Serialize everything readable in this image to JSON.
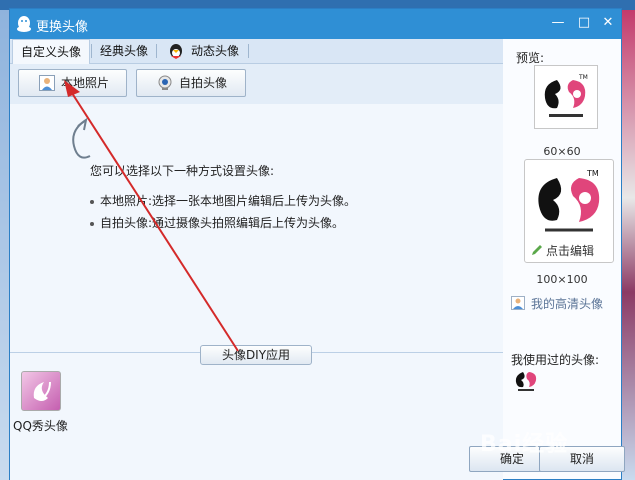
{
  "dialog": {
    "title": "更换头像",
    "controls": {
      "minimize": "—",
      "maximize": "□",
      "close": "✕"
    }
  },
  "tabs": [
    "自定义头像",
    "经典头像",
    "动态头像"
  ],
  "toolbar": {
    "local_photo": "本地照片",
    "selfie": "自拍头像"
  },
  "instructions": {
    "heading": "您可以选择以下一种方式设置头像:",
    "items": [
      "本地照片:选择一张本地图片编辑后上传为头像。",
      "自拍头像:通过摄像头拍照编辑后上传为头像。"
    ]
  },
  "diy_button": "头像DIY应用",
  "qq_show": {
    "label": "QQ秀头像"
  },
  "preview": {
    "label": "预览:",
    "small_size": "60×60",
    "large_size": "100×100",
    "edit_label": "点击编辑",
    "hd_link": "我的高清头像",
    "used_label": "我使用过的头像:"
  },
  "buttons": {
    "ok": "确定",
    "cancel": "取消"
  },
  "watermark": "Bai经验",
  "colors": {
    "titlebar": "#2f8fd5",
    "arrow": "#d42a2a",
    "logo": "#e0457b"
  }
}
